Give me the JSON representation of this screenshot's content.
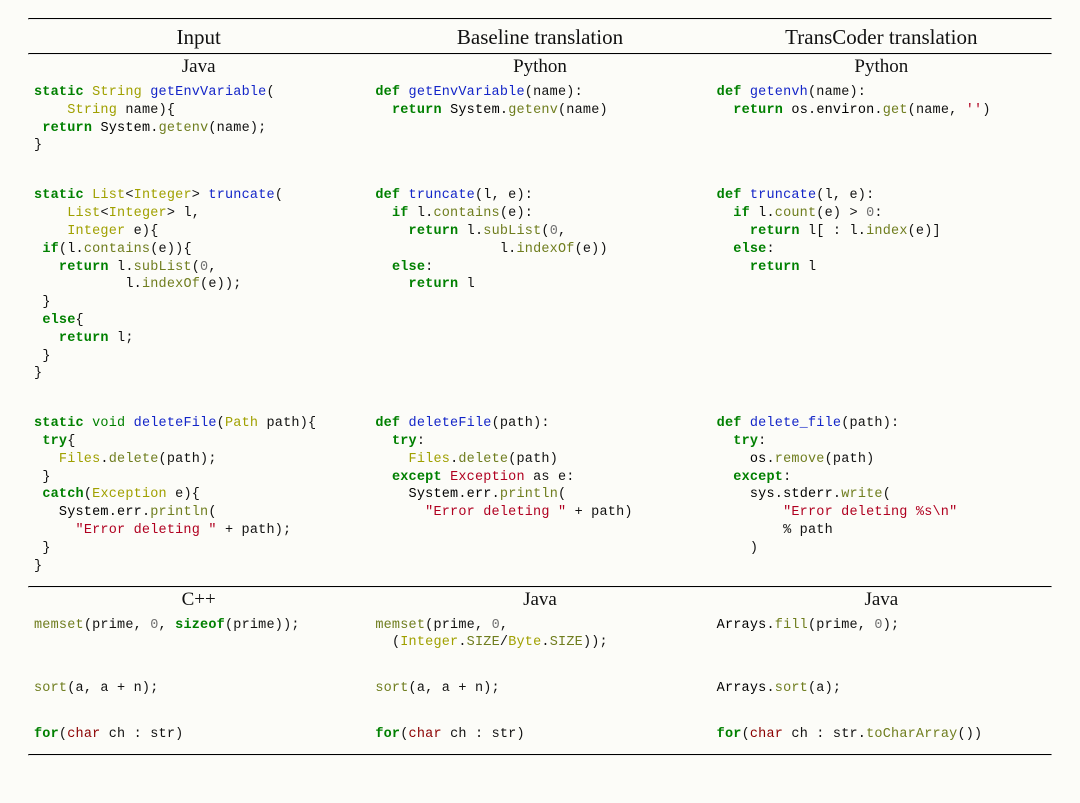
{
  "headers": {
    "c1": "Input",
    "c2": "Baseline translation",
    "c3": "TransCoder translation"
  },
  "langs1": {
    "c1": "Java",
    "c2": "Python",
    "c3": "Python"
  },
  "langs2": {
    "c1": "C++",
    "c2": "Java",
    "c3": "Java"
  },
  "r1c1": {
    "kw_static": "static",
    "ty_String": "String",
    "fn": "getEnvVariable",
    "lp": "(",
    "arg_ty": "String",
    "arg": "name",
    "rp": "){",
    "kw_return": "return",
    "sys": "System",
    "dot1": ".",
    "meth": "getenv",
    "call": "(name);",
    "close": "}"
  },
  "r1c2": {
    "kw_def": "def",
    "fn": "getEnvVariable",
    "sig": "(name):",
    "kw_return": "return",
    "sys": "System",
    "dot1": ".",
    "meth": "getenv",
    "call": "(name)"
  },
  "r1c3": {
    "kw_def": "def",
    "fn": "getenvh",
    "sig": "(name):",
    "kw_return": "return",
    "os": "os",
    "dot1": ".",
    "env": "environ",
    "dot2": ".",
    "meth": "get",
    "call": "(name, ",
    "str": "''",
    "rp": ")"
  },
  "r2c1": {
    "kw_static": "static",
    "ty_List": "List",
    "lt": "<",
    "ty_Int": "Integer",
    "gt": ">",
    "fn": "truncate",
    "lp": "(",
    "arg1_ty": "List",
    "arg1_lt": "<",
    "arg1_int": "Integer",
    "arg1_gt": ">",
    "arg1": " l,",
    "arg2_ty": "Integer",
    "arg2": " e){",
    "kw_if": "if",
    "cond_pre": "(l.",
    "m_contains": "contains",
    "cond_post": "(e)){",
    "kw_return": "return",
    "ret_pre": " l.",
    "m_sub": "subList",
    "ret_args": "(",
    "zero": "0",
    "comma": ",",
    "l_pre": "l.",
    "m_idx": "indexOf",
    "idx_post": "(e));",
    "c1": "}",
    "kw_else": "else",
    "else_brace": "{",
    "kw_return2": "return",
    "ret2": " l;",
    "c2": "}",
    "c3": "}"
  },
  "r2c2": {
    "kw_def": "def",
    "fn": "truncate",
    "sig": "(l, e):",
    "kw_if": "if",
    "cond_pre": " l.",
    "m_contains": "contains",
    "cond_post": "(e):",
    "kw_return": "return",
    "ret_pre": " l.",
    "m_sub": "subList",
    "ret_args": "(",
    "zero": "0",
    "comma": ",",
    "l_pre": "l.",
    "m_idx": "indexOf",
    "idx_post": "(e))",
    "kw_else": "else",
    "colon": ":",
    "kw_return2": "return",
    "ret2": " l"
  },
  "r2c3": {
    "kw_def": "def",
    "fn": "truncate",
    "sig": "(l, e):",
    "kw_if": "if",
    "cond_pre": " l.",
    "m_count": "count",
    "cond_mid": "(e) > ",
    "zero": "0",
    "colon": ":",
    "kw_return": "return",
    "ret_pre": " l[ : l.",
    "m_idx": "index",
    "ret_post": "(e)]",
    "kw_else": "else",
    "colon2": ":",
    "kw_return2": "return",
    "ret2": " l"
  },
  "r3c1": {
    "kw_static": "static",
    "ty_void": "void",
    "fn": "deleteFile",
    "lp": "(",
    "ty_Path": "Path",
    "arg": " path){",
    "kw_try": "try",
    "brace": "{",
    "files": "Files",
    "dot": ".",
    "m_del": "delete",
    "call": "(path);",
    "c1": "}",
    "kw_catch": "catch",
    "catch_args": "(",
    "ty_Exc": "Exception",
    "e": " e){",
    "sys": "System",
    "dot2": ".",
    "err": "err",
    "dot3": ".",
    "m_pl": "println",
    "paren": "(",
    "str": "\"Error deleting \"",
    "plus": " + path);",
    "c2": "}",
    "c3": "}"
  },
  "r3c2": {
    "kw_def": "def",
    "fn": "deleteFile",
    "sig": "(path):",
    "kw_try": "try",
    "colon": ":",
    "files": "Files",
    "dot": ".",
    "m_del": "delete",
    "call": "(path)",
    "kw_except": "except",
    "ty_Exc": "Exception",
    "as": " as e:",
    "sys": "System",
    "dot2": ".",
    "err": "err",
    "dot3": ".",
    "m_pl": "println",
    "paren": "(",
    "str": "\"Error deleting \"",
    "plus": " + path)"
  },
  "r3c3": {
    "kw_def": "def",
    "fn": "delete_file",
    "sig": "(path):",
    "kw_try": "try",
    "colon": ":",
    "os": "os",
    "dot": ".",
    "m_rem": "remove",
    "call": "(path)",
    "kw_except": "except",
    "colon2": ":",
    "sys": "sys",
    "dot2": ".",
    "stderr": "stderr",
    "dot3": ".",
    "m_wr": "write",
    "paren": "(",
    "str": "\"Error deleting %s\\n\"",
    "pct": "% path",
    "close": ")"
  },
  "r4c1": {
    "fn": "memset",
    "args_pre": "(prime, ",
    "zero": "0",
    "mid": ", ",
    "sizeof": "sizeof",
    "post": "(prime));"
  },
  "r4c2": {
    "fn": "memset",
    "args_pre": "(prime, ",
    "zero": "0",
    "mid": ",",
    "line2_pre": "(",
    "ty_Int": "Integer",
    "dot": ".",
    "m_size": "SIZE",
    "slash": "/",
    "ty_Byte": "Byte",
    "dot2": ".",
    "m_size2": "SIZE",
    "post": "));"
  },
  "r4c3": {
    "arr": "Arrays",
    "dot": ".",
    "m_fill": "fill",
    "args": "(prime, ",
    "zero": "0",
    "post": ");"
  },
  "r5c1": {
    "fn": "sort",
    "args": "(a, a + n);"
  },
  "r5c2": {
    "fn": "sort",
    "args": "(a, a + n);"
  },
  "r5c3": {
    "arr": "Arrays",
    "dot": ".",
    "m_sort": "sort",
    "args": "(a);"
  },
  "r6c1": {
    "kw_for": "for",
    "lp": "(",
    "char": "char",
    "rest": " ch : str)"
  },
  "r6c2": {
    "kw_for": "for",
    "lp": "(",
    "char": "char",
    "rest": " ch : str)"
  },
  "r6c3": {
    "kw_for": "for",
    "lp": "(",
    "char": "char",
    "mid": " ch : str.",
    "m": "toCharArray",
    "post": "())"
  }
}
